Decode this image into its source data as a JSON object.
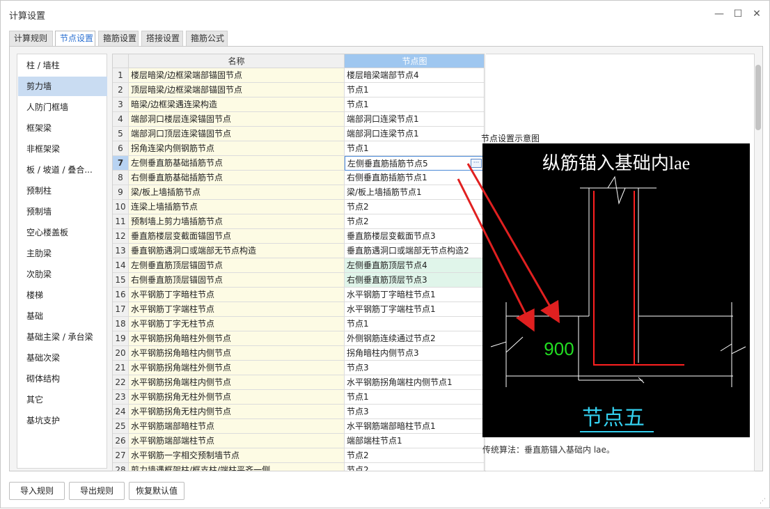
{
  "window": {
    "title": "计算设置",
    "minimize_glyph": "—",
    "maximize_glyph": "☐",
    "close_glyph": "✕"
  },
  "tabs": [
    {
      "label": "计算规则",
      "active": false
    },
    {
      "label": "节点设置",
      "active": true
    },
    {
      "label": "箍筋设置",
      "active": false
    },
    {
      "label": "搭接设置",
      "active": false
    },
    {
      "label": "箍筋公式",
      "active": false
    }
  ],
  "sidebar": {
    "items": [
      {
        "label": "柱 / 墙柱"
      },
      {
        "label": "剪力墙",
        "selected": true
      },
      {
        "label": "人防门框墙"
      },
      {
        "label": "框架梁"
      },
      {
        "label": "非框架梁"
      },
      {
        "label": "板 / 坡道 / 叠合..."
      },
      {
        "label": "预制柱"
      },
      {
        "label": "预制墙"
      },
      {
        "label": "空心楼盖板"
      },
      {
        "label": "主肋梁"
      },
      {
        "label": "次肋梁"
      },
      {
        "label": "楼梯"
      },
      {
        "label": "基础"
      },
      {
        "label": "基础主梁 / 承台梁"
      },
      {
        "label": "基础次梁"
      },
      {
        "label": "砌体结构"
      },
      {
        "label": "其它"
      },
      {
        "label": "基坑支护"
      }
    ]
  },
  "table": {
    "headers": {
      "name": "名称",
      "diagram": "节点图"
    },
    "ellipsis_label": "···",
    "rows": [
      {
        "num": "1",
        "name": "楼层暗梁/边框梁端部锚固节点",
        "value": "楼层暗梁端部节点4"
      },
      {
        "num": "2",
        "name": "顶层暗梁/边框梁端部锚固节点",
        "value": "节点1"
      },
      {
        "num": "3",
        "name": "暗梁/边框梁遇连梁构造",
        "value": "节点1"
      },
      {
        "num": "4",
        "name": "端部洞口楼层连梁锚固节点",
        "value": "端部洞口连梁节点1"
      },
      {
        "num": "5",
        "name": "端部洞口顶层连梁锚固节点",
        "value": "端部洞口连梁节点1"
      },
      {
        "num": "6",
        "name": "拐角连梁内侧钢筋节点",
        "value": "节点1"
      },
      {
        "num": "7",
        "name": "左侧垂直筋基础插筋节点",
        "value": "左侧垂直筋插筋节点5",
        "selected": true
      },
      {
        "num": "8",
        "name": "右侧垂直筋基础插筋节点",
        "value": "右侧垂直筋插筋节点1"
      },
      {
        "num": "9",
        "name": "梁/板上墙插筋节点",
        "value": "梁/板上墙插筋节点1"
      },
      {
        "num": "10",
        "name": "连梁上墙插筋节点",
        "value": "节点2"
      },
      {
        "num": "11",
        "name": "预制墙上剪力墙插筋节点",
        "value": "节点2"
      },
      {
        "num": "12",
        "name": "垂直筋楼层变截面锚固节点",
        "value": "垂直筋楼层变截面节点3"
      },
      {
        "num": "13",
        "name": "垂直钢筋遇洞口或端部无节点构造",
        "value": "垂直筋遇洞口或端部无节点构造2"
      },
      {
        "num": "14",
        "name": "左侧垂直筋顶层锚固节点",
        "value": "左侧垂直筋顶层节点4",
        "highlight": true
      },
      {
        "num": "15",
        "name": "右侧垂直筋顶层锚固节点",
        "value": "右侧垂直筋顶层节点3",
        "highlight": true
      },
      {
        "num": "16",
        "name": "水平钢筋丁字暗柱节点",
        "value": "水平钢筋丁字暗柱节点1"
      },
      {
        "num": "17",
        "name": "水平钢筋丁字端柱节点",
        "value": "水平钢筋丁字端柱节点1"
      },
      {
        "num": "18",
        "name": "水平钢筋丁字无柱节点",
        "value": "节点1"
      },
      {
        "num": "19",
        "name": "水平钢筋拐角暗柱外侧节点",
        "value": "外侧钢筋连续通过节点2"
      },
      {
        "num": "20",
        "name": "水平钢筋拐角暗柱内侧节点",
        "value": "拐角暗柱内侧节点3"
      },
      {
        "num": "21",
        "name": "水平钢筋拐角端柱外侧节点",
        "value": "节点3"
      },
      {
        "num": "22",
        "name": "水平钢筋拐角端柱内侧节点",
        "value": "水平钢筋拐角端柱内侧节点1"
      },
      {
        "num": "23",
        "name": "水平钢筋拐角无柱外侧节点",
        "value": "节点1"
      },
      {
        "num": "24",
        "name": "水平钢筋拐角无柱内侧节点",
        "value": "节点3"
      },
      {
        "num": "25",
        "name": "水平钢筋端部暗柱节点",
        "value": "水平钢筋端部暗柱节点1"
      },
      {
        "num": "26",
        "name": "水平钢筋端部端柱节点",
        "value": "端部端柱节点1"
      },
      {
        "num": "27",
        "name": "水平钢筋一字相交预制墙节点",
        "value": "节点2"
      },
      {
        "num": "28",
        "name": "剪力墙遇框架柱/框支柱/端柱平齐一侧",
        "value": "节点2"
      }
    ]
  },
  "diagram": {
    "title": "节点设置示意图",
    "heading": "纵筋锚入基础内lae",
    "dimension": "900",
    "caption": "节点五",
    "note": "传统算法：垂直筋锚入基础内 lae。",
    "colors": {
      "bg": "#000000",
      "lines": "#ffffff",
      "rebar": "#ff2020",
      "dimension": "#22dd22",
      "caption": "#33cfee",
      "arrow": "#e02020"
    }
  },
  "buttons": {
    "import": "导入规则",
    "export": "导出规则",
    "restore": "恢复默认值"
  }
}
